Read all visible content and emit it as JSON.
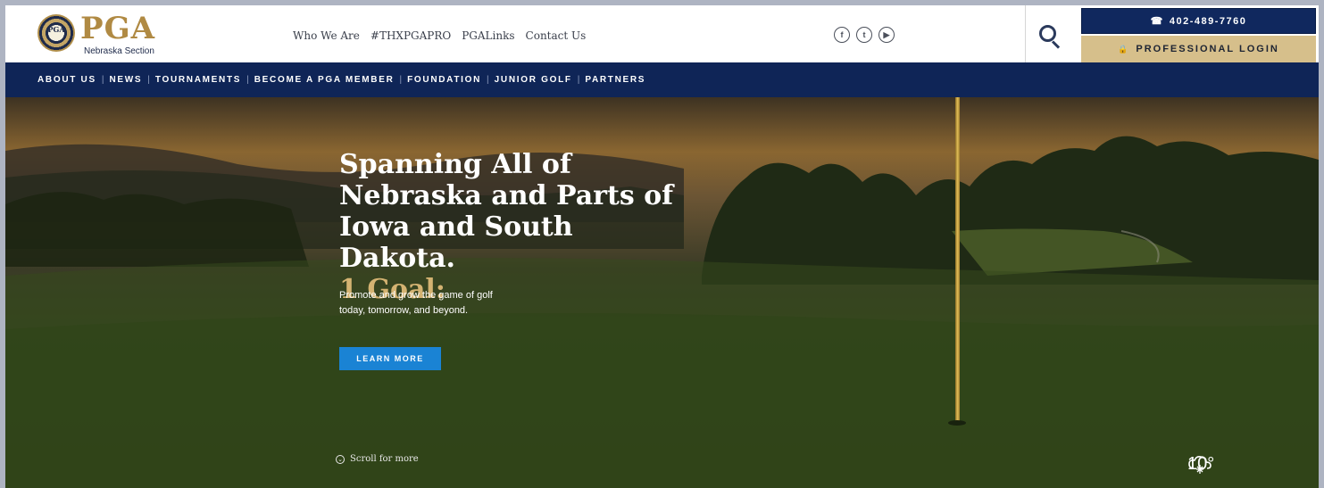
{
  "brand": {
    "seal_text": "PGA",
    "logo_word": "PGA",
    "logo_sub": "Nebraska Section"
  },
  "top_nav": {
    "items": [
      "Who We Are",
      "#THXPGAPRO",
      "PGALinks",
      "Contact Us"
    ]
  },
  "social": {
    "icons": [
      "facebook-icon",
      "twitter-icon",
      "youtube-icon"
    ],
    "glyphs": [
      "f",
      "t",
      "▶"
    ]
  },
  "header": {
    "phone": "402-489-7760",
    "phone_icon": "☎",
    "login_label": "PROFESSIONAL LOGIN",
    "login_icon": "🔒"
  },
  "main_nav": {
    "items": [
      "ABOUT US",
      "NEWS",
      "TOURNAMENTS",
      "BECOME A PGA MEMBER",
      "FOUNDATION",
      "JUNIOR GOLF",
      "PARTNERS"
    ],
    "separator": "|"
  },
  "hero": {
    "headline_line1": "Spanning All of",
    "headline_line2": "Nebraska and Parts of",
    "headline_line3": "Iowa and South Dakota.",
    "goal": "1 Goal:",
    "blurb_line1": "Promote and grow the game of golf",
    "blurb_line2": "today, tomorrow, and beyond.",
    "cta_label": "LEARN MORE",
    "scroll_label": "Scroll for more",
    "weather_temp": "10°"
  },
  "colors": {
    "navy": "#0f2557",
    "gold": "#b08a43",
    "login_bg": "#d6bf8b",
    "cta_blue": "#1a83d4"
  }
}
